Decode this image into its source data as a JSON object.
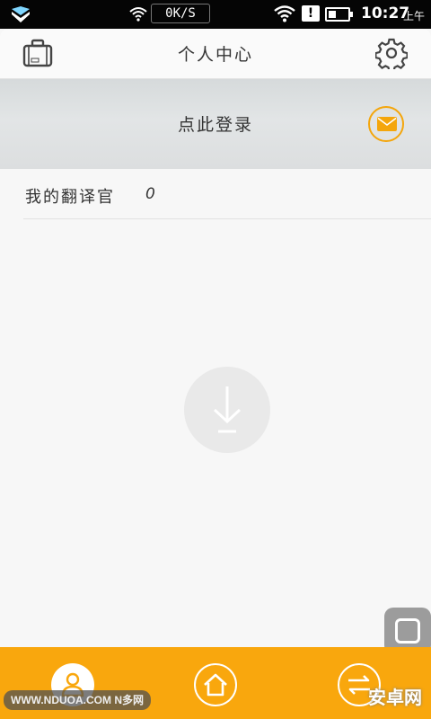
{
  "status_bar": {
    "network_speed": "0K/S",
    "alert": "!",
    "time": "10:27",
    "ampm": "上午"
  },
  "header": {
    "title": "个人中心",
    "suitcase_icon": "suitcase-icon",
    "settings_icon": "gear-icon"
  },
  "login": {
    "label": "点此登录",
    "icon": "mail-icon",
    "accent": "#f4a60c"
  },
  "translator": {
    "label": "我的翻译官",
    "count": "0"
  },
  "center_icon": "download-icon",
  "bottom_nav": {
    "background": "#f9a70d",
    "items": [
      {
        "icon": "person-icon",
        "active": true
      },
      {
        "icon": "home-icon",
        "active": false
      },
      {
        "icon": "swap-arrows-icon",
        "active": false
      }
    ]
  },
  "watermarks": {
    "left": "WWW.NDUOA.COM N多网",
    "right": "安卓网"
  }
}
